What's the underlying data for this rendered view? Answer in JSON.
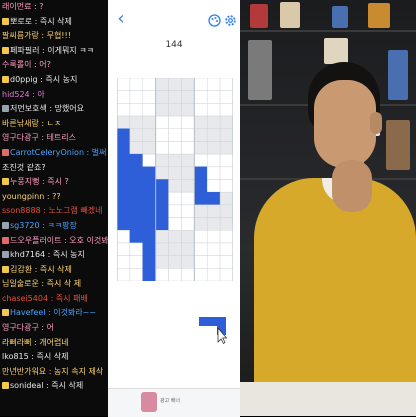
{
  "chat": {
    "lines": [
      {
        "text": "래이먼료 : ?",
        "color": "#ff9bc2",
        "icon": "none"
      },
      {
        "text": "뽀로로 : 즉시 삭제",
        "color": "#e8e8e8",
        "icon": "smile-badge-icon",
        "icon_color": "#f2c94c"
      },
      {
        "text": "팔씨름가랑 : 무협!!!",
        "color": "#ffd36b",
        "icon": "none"
      },
      {
        "text": "페파필러 : 이게뭐지 ㅋㅋ",
        "color": "#e8e8e8",
        "icon": "smile-badge-icon",
        "icon_color": "#f2c94c"
      },
      {
        "text": "수룩롤이 : 어?",
        "color": "#ff9bc2",
        "icon": "none"
      },
      {
        "text": "d0ppig : 즉시 농지",
        "color": "#e8e8e8",
        "icon": "smile-badge-icon",
        "icon_color": "#f2c94c"
      },
      {
        "text": "hid524 : 아",
        "color": "#e27ad6",
        "icon": "none"
      },
      {
        "text": "저먼보호색 : 망했어요",
        "color": "#e8e8e8",
        "icon": "sub-badge-icon",
        "icon_color": "#9aa2ad"
      },
      {
        "text": "바른낚새랑 : ㄴㅈ",
        "color": "#ffd36b",
        "icon": "none"
      },
      {
        "text": "영구다광구 : 테트리스",
        "color": "#ff9bc2",
        "icon": "none"
      },
      {
        "text": "CarrotCeleryOnion : 벌써",
        "color": "#4aa3ff",
        "icon": "sub-badge-icon",
        "icon_color": "#e06a6a"
      },
      {
        "text": "조진것 같죠?",
        "color": "#e8e8e8",
        "icon": "none"
      },
      {
        "text": "누풍지뻥 : 즉시 ?",
        "color": "#ff9bc2",
        "icon": "smile-badge-icon",
        "icon_color": "#f2c94c"
      },
      {
        "text": "youngpinn : ??",
        "color": "#ffd36b",
        "icon": "none"
      },
      {
        "text": "sson8888 : 노노그램 빼겠네",
        "color": "#e2503f",
        "icon": "none"
      },
      {
        "text": "sg3720 : ㅋㅋ팡장",
        "color": "#4aa3ff",
        "icon": "sub-badge-icon",
        "icon_color": "#9aa2ad"
      },
      {
        "text": "드오우플러이트 : 오호 이것봐라",
        "color": "#ff9bc2",
        "icon": "sub-badge-icon",
        "icon_color": "#e06a6a"
      },
      {
        "text": "khd7164 : 즉시 농지",
        "color": "#e8e8e8",
        "icon": "sub-badge-icon",
        "icon_color": "#9aa2ad"
      },
      {
        "text": "김감환 : 즉시 삭제",
        "color": "#ffd36b",
        "icon": "smile-badge-icon",
        "icon_color": "#f2c94c"
      },
      {
        "text": "님일술로운 : 즉시 삭 제",
        "color": "#ffd36b",
        "icon": "none"
      },
      {
        "text": "chasei5404 : 즉시 패배",
        "color": "#e2503f",
        "icon": "none"
      },
      {
        "text": "Havefeel : 이것봐라~~",
        "color": "#4aa3ff",
        "icon": "smile-badge-icon",
        "icon_color": "#f2c94c"
      },
      {
        "text": "영구다광구 : 어",
        "color": "#ff9bc2",
        "icon": "none"
      },
      {
        "text": "라뻐라뻐 : 개어렵네",
        "color": "#ffd36b",
        "icon": "none"
      },
      {
        "text": "lko815 : 즉시 삭제",
        "color": "#e8e8e8",
        "icon": "none"
      },
      {
        "text": "만년반가워요 : 농지 속지 제삭",
        "color": "#ffd36b",
        "icon": "none"
      },
      {
        "text": "sonideal : 즉시 삭제",
        "color": "#e8e8e8",
        "icon": "smile-badge-icon",
        "icon_color": "#f2c94c"
      },
      {
        "text": "",
        "color": "#e8e8e8",
        "icon": "none"
      }
    ]
  },
  "game": {
    "score": "144",
    "back_icon": "back-chevron-icon",
    "palette_icon": "palette-icon",
    "gear_icon": "gear-icon",
    "colors": {
      "accent": "#2f80ed",
      "block": "#2e5fd9",
      "empty": "#ffffff",
      "shaded": "#e7e9ed",
      "grid": "#cfd3d9"
    },
    "board": {
      "cols": 9,
      "rows": 16,
      "shaded_regions": [
        {
          "c0": 3,
          "r0": 0,
          "c1": 5,
          "r1": 2
        },
        {
          "c0": 0,
          "r0": 3,
          "c1": 2,
          "r1": 5
        },
        {
          "c0": 6,
          "r0": 3,
          "c1": 8,
          "r1": 5
        },
        {
          "c0": 3,
          "r0": 6,
          "c1": 5,
          "r1": 8
        },
        {
          "c0": 0,
          "r0": 9,
          "c1": 2,
          "r1": 11
        },
        {
          "c0": 6,
          "r0": 9,
          "c1": 8,
          "r1": 11
        },
        {
          "c0": 3,
          "r0": 12,
          "c1": 5,
          "r1": 14
        }
      ],
      "filled": [
        [
          0,
          4
        ],
        [
          0,
          5
        ],
        [
          0,
          6
        ],
        [
          0,
          7
        ],
        [
          0,
          8
        ],
        [
          0,
          9
        ],
        [
          0,
          10
        ],
        [
          0,
          11
        ],
        [
          1,
          6
        ],
        [
          1,
          7
        ],
        [
          1,
          8
        ],
        [
          1,
          9
        ],
        [
          1,
          10
        ],
        [
          1,
          11
        ],
        [
          1,
          12
        ],
        [
          2,
          7
        ],
        [
          2,
          8
        ],
        [
          2,
          9
        ],
        [
          2,
          10
        ],
        [
          2,
          11
        ],
        [
          2,
          12
        ],
        [
          2,
          13
        ],
        [
          2,
          14
        ],
        [
          2,
          15
        ],
        [
          3,
          8
        ],
        [
          3,
          9
        ],
        [
          3,
          10
        ],
        [
          3,
          11
        ],
        [
          6,
          7
        ],
        [
          6,
          8
        ],
        [
          6,
          9
        ],
        [
          7,
          9
        ]
      ]
    },
    "next_piece": {
      "cells": [
        [
          0,
          0
        ],
        [
          1,
          0
        ],
        [
          2,
          0
        ],
        [
          2,
          1
        ]
      ]
    },
    "ad_text": "광고 배너"
  },
  "webcam": {
    "shelf_colors": [
      "#b23a3a",
      "#d9c9a8",
      "#4a6fb0",
      "#c98b2f",
      "#7a7a7a",
      "#e0d6c0"
    ]
  }
}
